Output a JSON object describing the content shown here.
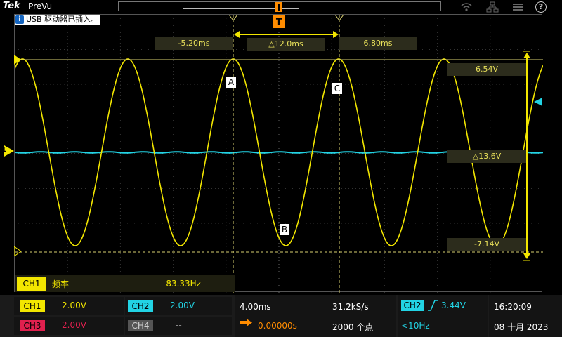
{
  "topbar": {
    "brand": "Tek",
    "mode": "PreVu",
    "icons": [
      "wifi-icon",
      "network-icon",
      "menu-icon",
      "help-icon"
    ],
    "help_glyph": "?"
  },
  "notice": {
    "text": "USB 驱动器已插入。"
  },
  "markers": {
    "trigger_t": "T",
    "ground": "1",
    "ch2_level": "1"
  },
  "cursors": {
    "left_time": "-5.20ms",
    "delta_time": "△12.0ms",
    "right_time": "6.80ms",
    "upper_volt": "6.54V",
    "delta_volt": "△13.6V",
    "lower_volt": "-7.14V",
    "labels": {
      "a": "A",
      "b": "B",
      "c": "C"
    }
  },
  "measurement": {
    "channel": "CH1",
    "name": "频率",
    "value": "83.33Hz"
  },
  "channels": [
    {
      "tag": "CH1",
      "scale": "2.00V",
      "color": "#f2e600",
      "tag_text_color": "#000000"
    },
    {
      "tag": "CH2",
      "scale": "2.00V",
      "color": "#22d3e4",
      "tag_text_color": "#000000"
    },
    {
      "tag": "CH3",
      "scale": "2.00V",
      "color": "#e0204e",
      "tag_text_color": "#000000"
    },
    {
      "tag": "CH4",
      "scale": "--",
      "color": "#555555",
      "tag_text_color": "#cfcfcf"
    }
  ],
  "horizontal": {
    "scale": "4.00ms",
    "sample_rate": "31.2kS/s",
    "position": "0.00000s",
    "record_length": "2000 个点"
  },
  "trigger": {
    "source": "CH2",
    "level": "3.44V",
    "frequency": "<10Hz"
  },
  "clock": {
    "time": "16:20:09",
    "date": "08 十月 2023"
  },
  "colors": {
    "ch1": "#f2e600",
    "ch2": "#22d3e4",
    "ch3": "#e0204e",
    "trigger": "#ff8c00",
    "cursor": "#e8e05a"
  }
}
